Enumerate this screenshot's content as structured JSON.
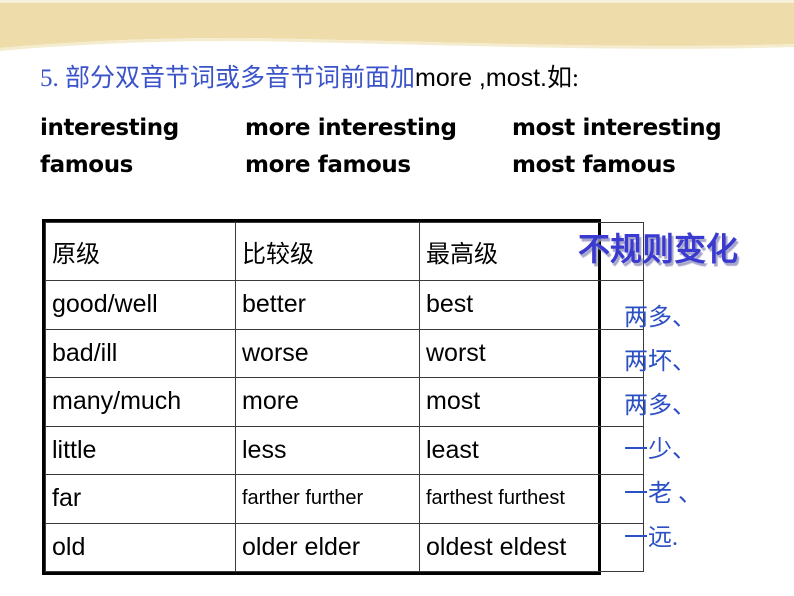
{
  "slide": {
    "banner_color": "#EEDDAA",
    "accent_blue": "#3A53C8",
    "note_blue": "#2B4FC4"
  },
  "heading": {
    "chinese_lead": "5. 部分双音节词或多音节词前面加",
    "english_part": "more ,most.",
    "chinese_tail": "如:"
  },
  "examples": {
    "rows": [
      {
        "positive": "interesting",
        "comparative": "more interesting",
        "superlative": "most interesting"
      },
      {
        "positive": "famous",
        "comparative": "more famous",
        "superlative": "most famous"
      }
    ]
  },
  "table": {
    "headers": [
      "原级",
      "比较级",
      "最高级"
    ],
    "rows": [
      {
        "positive": "good/well",
        "comparative": "better",
        "superlative": "best",
        "small": false
      },
      {
        "positive": "bad/ill",
        "comparative": "worse",
        "superlative": "worst",
        "small": false
      },
      {
        "positive": "many/much",
        "comparative": "more",
        "superlative": "most",
        "small": false
      },
      {
        "positive": "little",
        "comparative": "less",
        "superlative": "least",
        "small": false
      },
      {
        "positive": "far",
        "comparative": "farther further",
        "superlative": "farthest  furthest",
        "small": true
      },
      {
        "positive": "old",
        "comparative": "older elder",
        "superlative": "oldest  eldest",
        "small": false
      }
    ]
  },
  "sidebar": {
    "title": "不规则变化",
    "notes": [
      "两多、",
      "两坏、",
      "两多、",
      "一少、",
      "一老 、",
      "一远."
    ]
  }
}
